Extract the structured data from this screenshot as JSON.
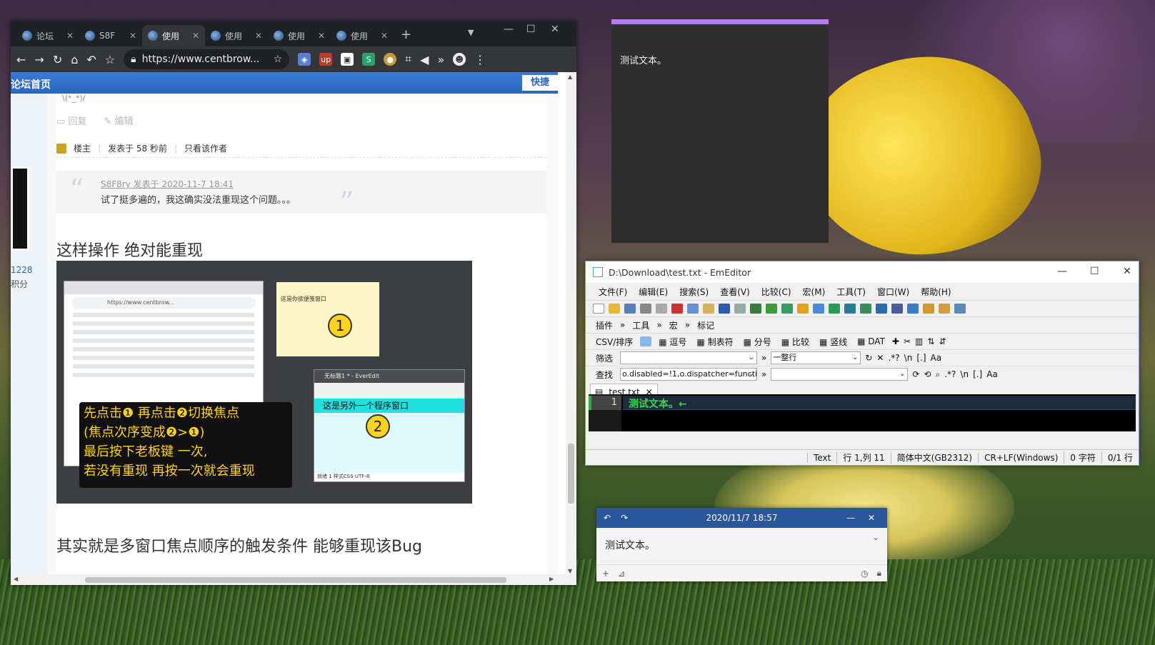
{
  "browser": {
    "tabs": [
      {
        "label": "论坛",
        "active": false
      },
      {
        "label": "S8F",
        "active": false
      },
      {
        "label": "使用",
        "active": true
      },
      {
        "label": "使用",
        "active": false
      },
      {
        "label": "使用",
        "active": false
      },
      {
        "label": "使用",
        "active": false
      }
    ],
    "new_tab": "+",
    "url": "https://www.centbrow...",
    "nav": {
      "back": "←",
      "forward": "→",
      "reload": "↻",
      "home": "⌂",
      "undo": "↶",
      "star": "☆"
    },
    "extensions": [
      "shield-icon",
      "up-badge-icon",
      "ext-badge-icon",
      "s-icon",
      "cookie-icon",
      "crop-icon",
      "mute-icon",
      "chevrons-icon",
      "avatar-icon",
      "menu-icon"
    ]
  },
  "forum": {
    "home_label": "论坛首页",
    "quick_label": "快捷",
    "faint_text": "\\(*_*)/",
    "left": {
      "uid": "1228",
      "points": "积分"
    },
    "actions": {
      "reply": "回复",
      "edit": "编辑"
    },
    "meta": {
      "author_role": "楼主",
      "posted": "发表于 58 秒前",
      "only_author": "只看该作者"
    },
    "quote": {
      "header": "S8F8ry 发表于 2020-11-7 18:41",
      "body": "试了挺多遍的，我这确实没法重现这个问题。。。"
    },
    "heading1": "这样操作 绝对能重现",
    "heading2": "其实就是多窗口焦点顺序的触发条件 能够重现该Bug",
    "screenshot": {
      "mini_url": "https://www.centbrow...",
      "sticky_text": "这是你欲便笺窗口",
      "circle1": "1",
      "circle2": "2",
      "ever_title": "无标题1 * - EverEdit",
      "ever_line": "这是另外一个程序窗口",
      "ever_status": "就绪          1     样式CSS   UTF-8",
      "overlay_lines": [
        "先点击❶ 再点击❷切换焦点",
        "(焦点次序变成❷>❶)",
        "最后按下老板键 一次,",
        "若没有重现 再按一次就会重现"
      ]
    }
  },
  "darknote": {
    "text": "测试文本。",
    "accent": "#b47cf2"
  },
  "emeditor": {
    "title": "D:\\Download\\test.txt - EmEditor",
    "menus": [
      "文件(F)",
      "编辑(E)",
      "搜索(S)",
      "查看(V)",
      "比较(C)",
      "宏(M)",
      "工具(T)",
      "窗口(W)",
      "帮助(H)"
    ],
    "toolbar_row2": [
      "插件",
      "工具",
      "宏",
      "标记"
    ],
    "csv_row": [
      "CSV/排序",
      "逗号",
      "制表符",
      "分号",
      "比较",
      "竖线",
      "DAT"
    ],
    "filter_label": "筛选",
    "filter_mode": "一整行",
    "find_label": "查找",
    "find_value": "o.disabled=!1,o.dispatcher=function",
    "doc_tab": "test.txt",
    "line_number": "1",
    "line_text": "测试文本。←",
    "status": {
      "mode": "Text",
      "position": "行 1,列 11",
      "encoding": "简体中文(GB2312)",
      "newline": "CR+LF(Windows)",
      "chars": "0 字符",
      "lines": "0/1 行"
    }
  },
  "notewin": {
    "date": "2020/11/7 18:57",
    "text": "测试文本。",
    "header_color": "#2b579a"
  }
}
